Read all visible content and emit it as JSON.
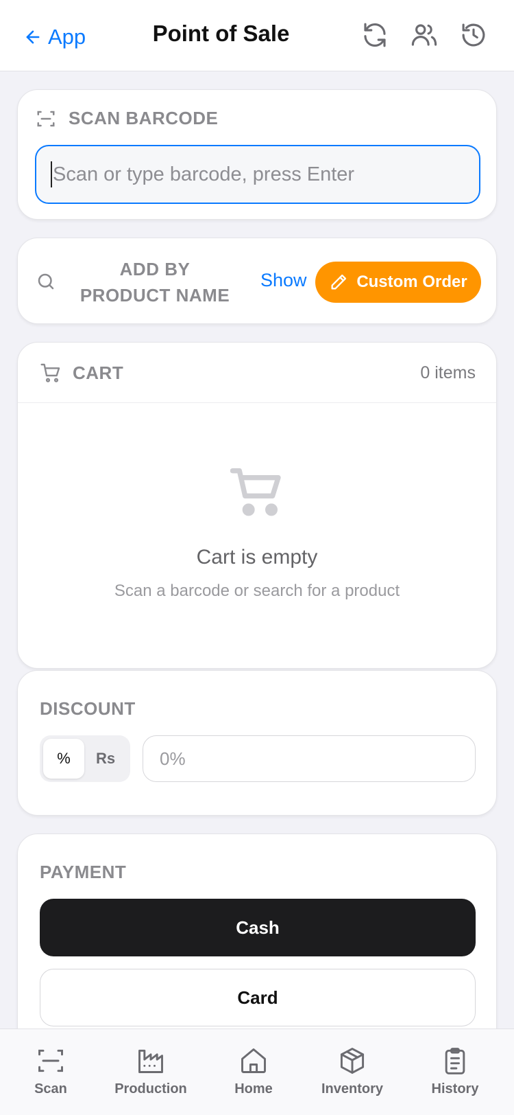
{
  "header": {
    "back_label": "App",
    "title": "Point of Sale",
    "icons": [
      "refresh-icon",
      "users-icon",
      "history-icon"
    ]
  },
  "scan": {
    "label": "SCAN BARCODE",
    "placeholder": "Scan or type barcode, press Enter"
  },
  "add_product": {
    "label": "ADD BY PRODUCT NAME",
    "show_label": "Show",
    "custom_order_label": "Custom Order"
  },
  "cart": {
    "label": "CART",
    "count": "0 items",
    "empty_title": "Cart is empty",
    "empty_subtitle": "Scan a barcode or search for a product"
  },
  "discount": {
    "label": "DISCOUNT",
    "percent_option": "%",
    "rs_option": "Rs",
    "selected": "%",
    "placeholder": "0%"
  },
  "payment": {
    "label": "PAYMENT",
    "options": [
      "Cash",
      "Card"
    ],
    "selected": "Cash"
  },
  "tabbar": {
    "tabs": [
      {
        "label": "Scan",
        "icon": "scan-icon"
      },
      {
        "label": "Production",
        "icon": "factory-icon"
      },
      {
        "label": "Home",
        "icon": "home-icon"
      },
      {
        "label": "Inventory",
        "icon": "box-icon"
      },
      {
        "label": "History",
        "icon": "clipboard-icon"
      }
    ]
  },
  "colors": {
    "accent": "#0a7aff",
    "custom_order": "#ff9500",
    "cash_button": "#1c1c1e",
    "background": "#f2f2f7"
  }
}
